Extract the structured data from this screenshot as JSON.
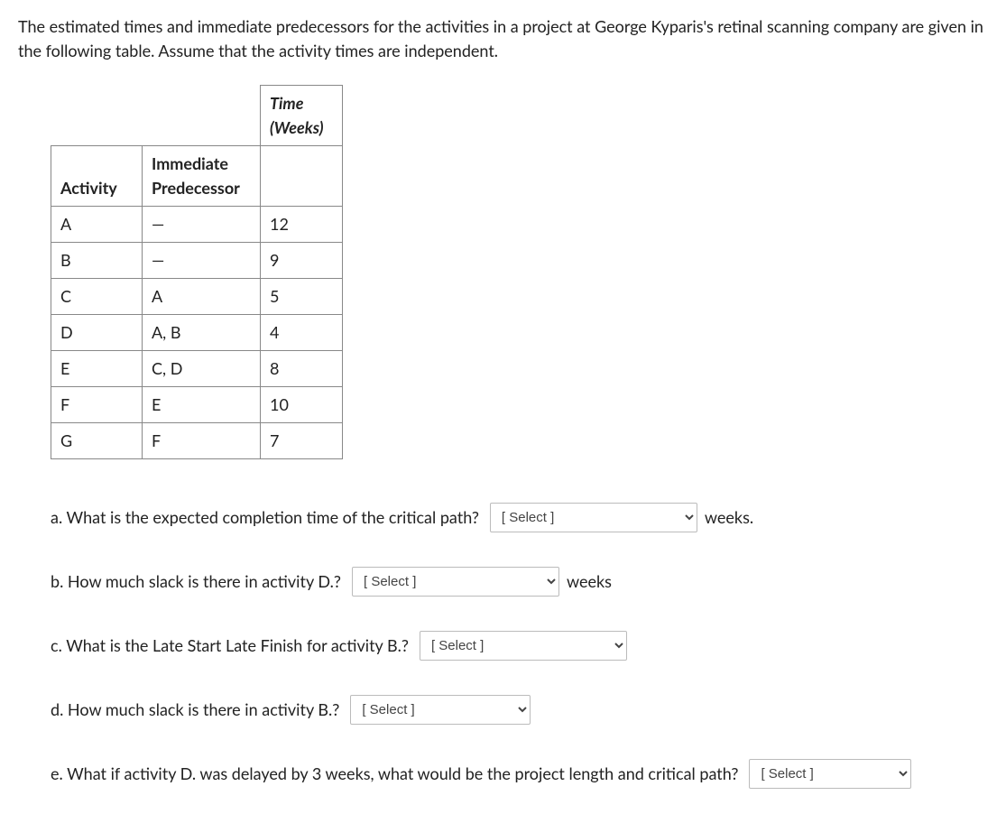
{
  "intro_text": "The estimated times and immediate predecessors for the activities in a project at George Kyparis's retinal scanning company are given in the following table. Assume that the activity times are independent.",
  "table": {
    "header_time": "Time (Weeks)",
    "header_activity": "Activity",
    "header_predecessor": "Immediate Predecessor",
    "rows": [
      {
        "activity": "A",
        "pred": "—",
        "time": "12"
      },
      {
        "activity": "B",
        "pred": "—",
        "time": "9"
      },
      {
        "activity": "C",
        "pred": "A",
        "time": "5"
      },
      {
        "activity": "D",
        "pred": "A, B",
        "time": "4"
      },
      {
        "activity": "E",
        "pred": "C, D",
        "time": "8"
      },
      {
        "activity": "F",
        "pred": "E",
        "time": "10"
      },
      {
        "activity": "G",
        "pred": "F",
        "time": "7"
      }
    ]
  },
  "questions": {
    "a": {
      "text": "a. What is the expected completion time of the critical path?",
      "select_placeholder": "[ Select ]",
      "suffix": "weeks."
    },
    "b": {
      "text": "b. How much slack is there in activity D.?",
      "select_placeholder": "[ Select ]",
      "suffix": "weeks"
    },
    "c": {
      "text": "c. What is the Late Start Late Finish for activity B.?",
      "select_placeholder": "[ Select ]"
    },
    "d": {
      "text": "d. How much slack is there in activity B.?",
      "select_placeholder": "[ Select ]"
    },
    "e": {
      "text": "e. What if activity D. was delayed by 3 weeks, what would be the project length and critical path?",
      "select_placeholder": "[ Select ]"
    }
  }
}
